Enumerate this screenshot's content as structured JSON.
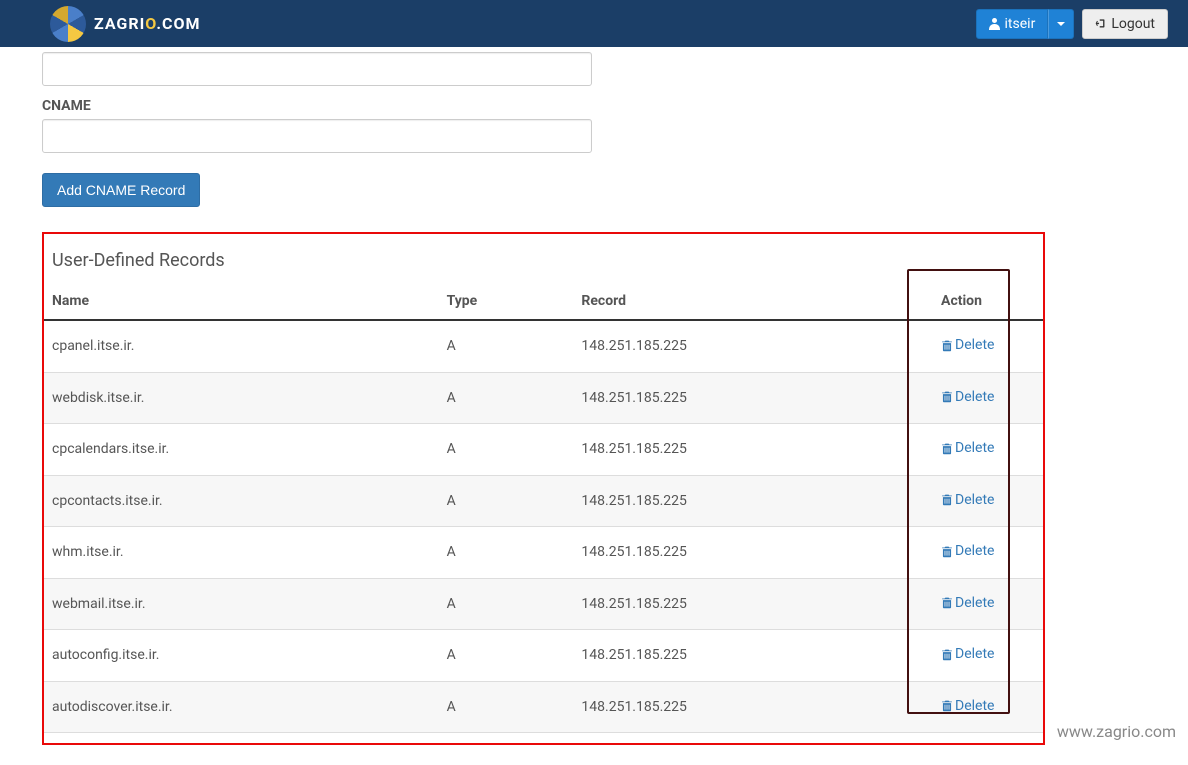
{
  "nav": {
    "brand_prefix": "ZAGRI",
    "brand_o": "O",
    "brand_suffix": ".COM",
    "user_label": "itseir",
    "logout_label": "Logout"
  },
  "form": {
    "cname_label": "CNAME",
    "add_button": "Add CNAME Record"
  },
  "section": {
    "title": "User-Defined Records",
    "headers": {
      "name": "Name",
      "type": "Type",
      "record": "Record",
      "action": "Action"
    },
    "delete_label": "Delete",
    "rows": [
      {
        "name": "cpanel.itse.ir.",
        "type": "A",
        "record": "148.251.185.225"
      },
      {
        "name": "webdisk.itse.ir.",
        "type": "A",
        "record": "148.251.185.225"
      },
      {
        "name": "cpcalendars.itse.ir.",
        "type": "A",
        "record": "148.251.185.225"
      },
      {
        "name": "cpcontacts.itse.ir.",
        "type": "A",
        "record": "148.251.185.225"
      },
      {
        "name": "whm.itse.ir.",
        "type": "A",
        "record": "148.251.185.225"
      },
      {
        "name": "webmail.itse.ir.",
        "type": "A",
        "record": "148.251.185.225"
      },
      {
        "name": "autoconfig.itse.ir.",
        "type": "A",
        "record": "148.251.185.225"
      },
      {
        "name": "autodiscover.itse.ir.",
        "type": "A",
        "record": "148.251.185.225"
      }
    ]
  },
  "watermark": "www.zagrio.com"
}
